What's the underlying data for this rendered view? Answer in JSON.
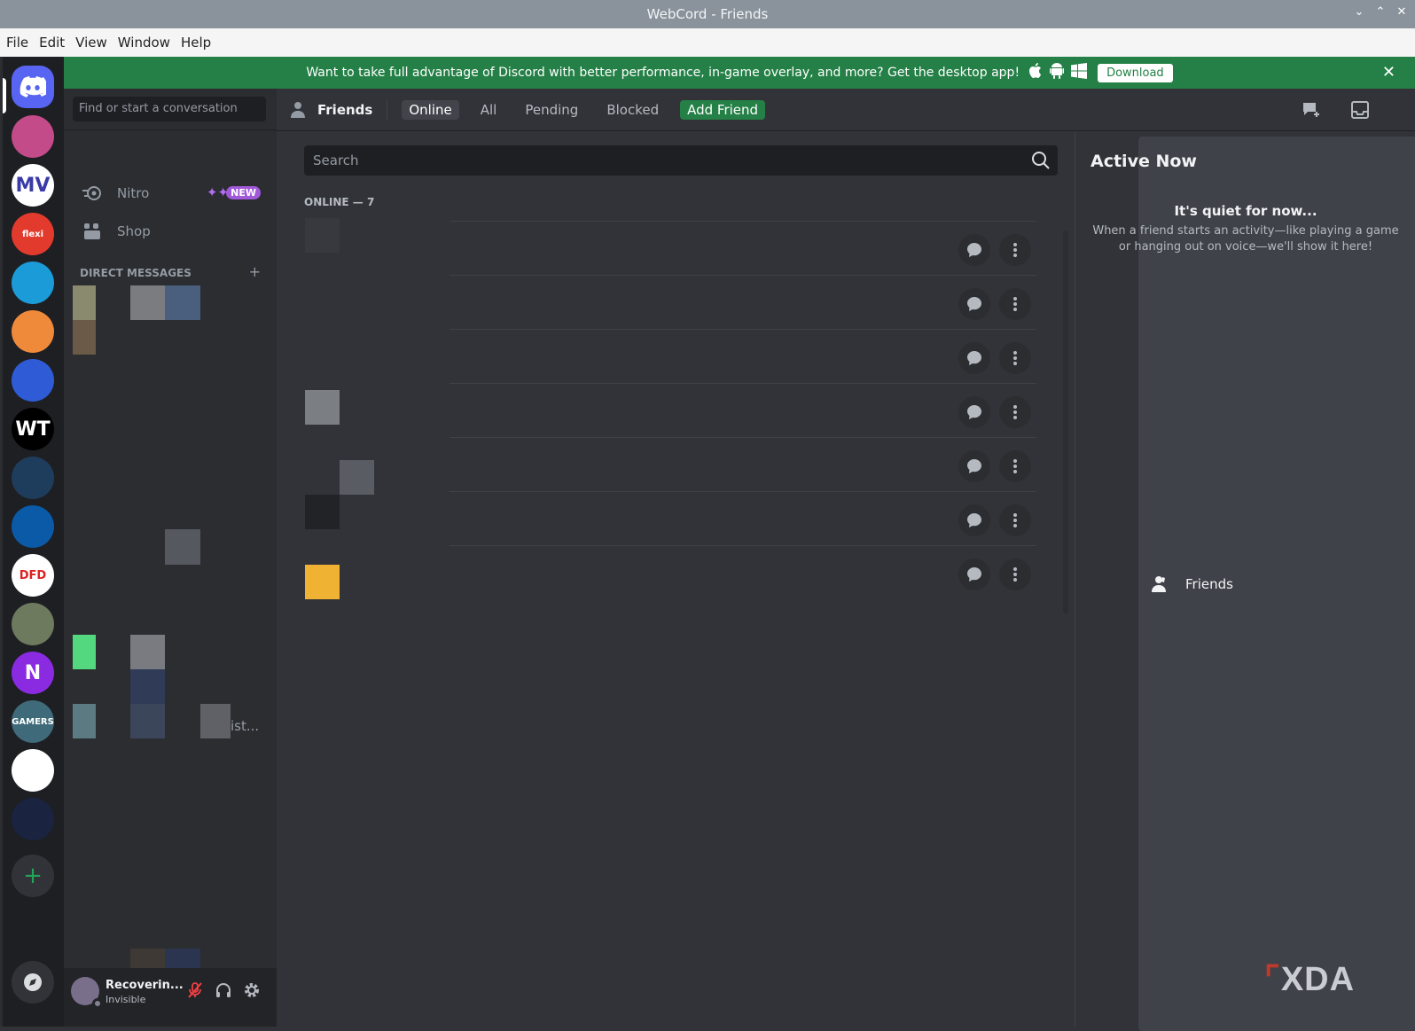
{
  "window": {
    "title": "WebCord - Friends"
  },
  "menu": [
    "File",
    "Edit",
    "View",
    "Window",
    "Help"
  ],
  "banner": {
    "text": "Want to take full advantage of Discord with better performance, in-game overlay, and more? Get the desktop app!",
    "download_label": "Download"
  },
  "sidebar": {
    "search_placeholder": "Find or start a conversation",
    "nav": [
      {
        "label": "Friends",
        "icon": "friends-icon"
      },
      {
        "label": "Nitro",
        "icon": "nitro-icon",
        "badge": "NEW"
      },
      {
        "label": "Shop",
        "icon": "shop-icon"
      }
    ],
    "dm_header": "DIRECT MESSAGES",
    "dm_truncated": "ist..."
  },
  "user": {
    "name": "Recoverin...",
    "status": "Invisible"
  },
  "header": {
    "title": "Friends",
    "tabs": [
      "Online",
      "All",
      "Pending",
      "Blocked"
    ],
    "add_friend": "Add Friend"
  },
  "friends": {
    "search_placeholder": "Search",
    "online_header": "ONLINE — 7",
    "count": 7
  },
  "active_now": {
    "title": "Active Now",
    "quiet": "It's quiet for now...",
    "desc": "When a friend starts an activity—like playing a game or hanging out on voice—we'll show it here!"
  },
  "watermark": "XDA",
  "servers": [
    {
      "label": "",
      "color": "#c44b8a"
    },
    {
      "label": "MV",
      "color": "#ffffff",
      "fg": "#3a3aa8"
    },
    {
      "label": "flexi",
      "color": "#e23b2e"
    },
    {
      "label": "",
      "color": "#1b9bd8"
    },
    {
      "label": "",
      "color": "#ef8a3b"
    },
    {
      "label": "",
      "color": "#2f5cd6"
    },
    {
      "label": "WT",
      "color": "#000000"
    },
    {
      "label": "",
      "color": "#1e3c5c"
    },
    {
      "label": "",
      "color": "#0b5aa8"
    },
    {
      "label": "DFD",
      "color": "#ffffff",
      "fg": "#d22"
    },
    {
      "label": "",
      "color": "#6d7a5e"
    },
    {
      "label": "N",
      "color": "#8a2be2"
    },
    {
      "label": "GAMERS",
      "color": "#3f6a7a"
    },
    {
      "label": "",
      "color": "#ffffff"
    },
    {
      "label": "",
      "color": "#1a2340"
    }
  ]
}
